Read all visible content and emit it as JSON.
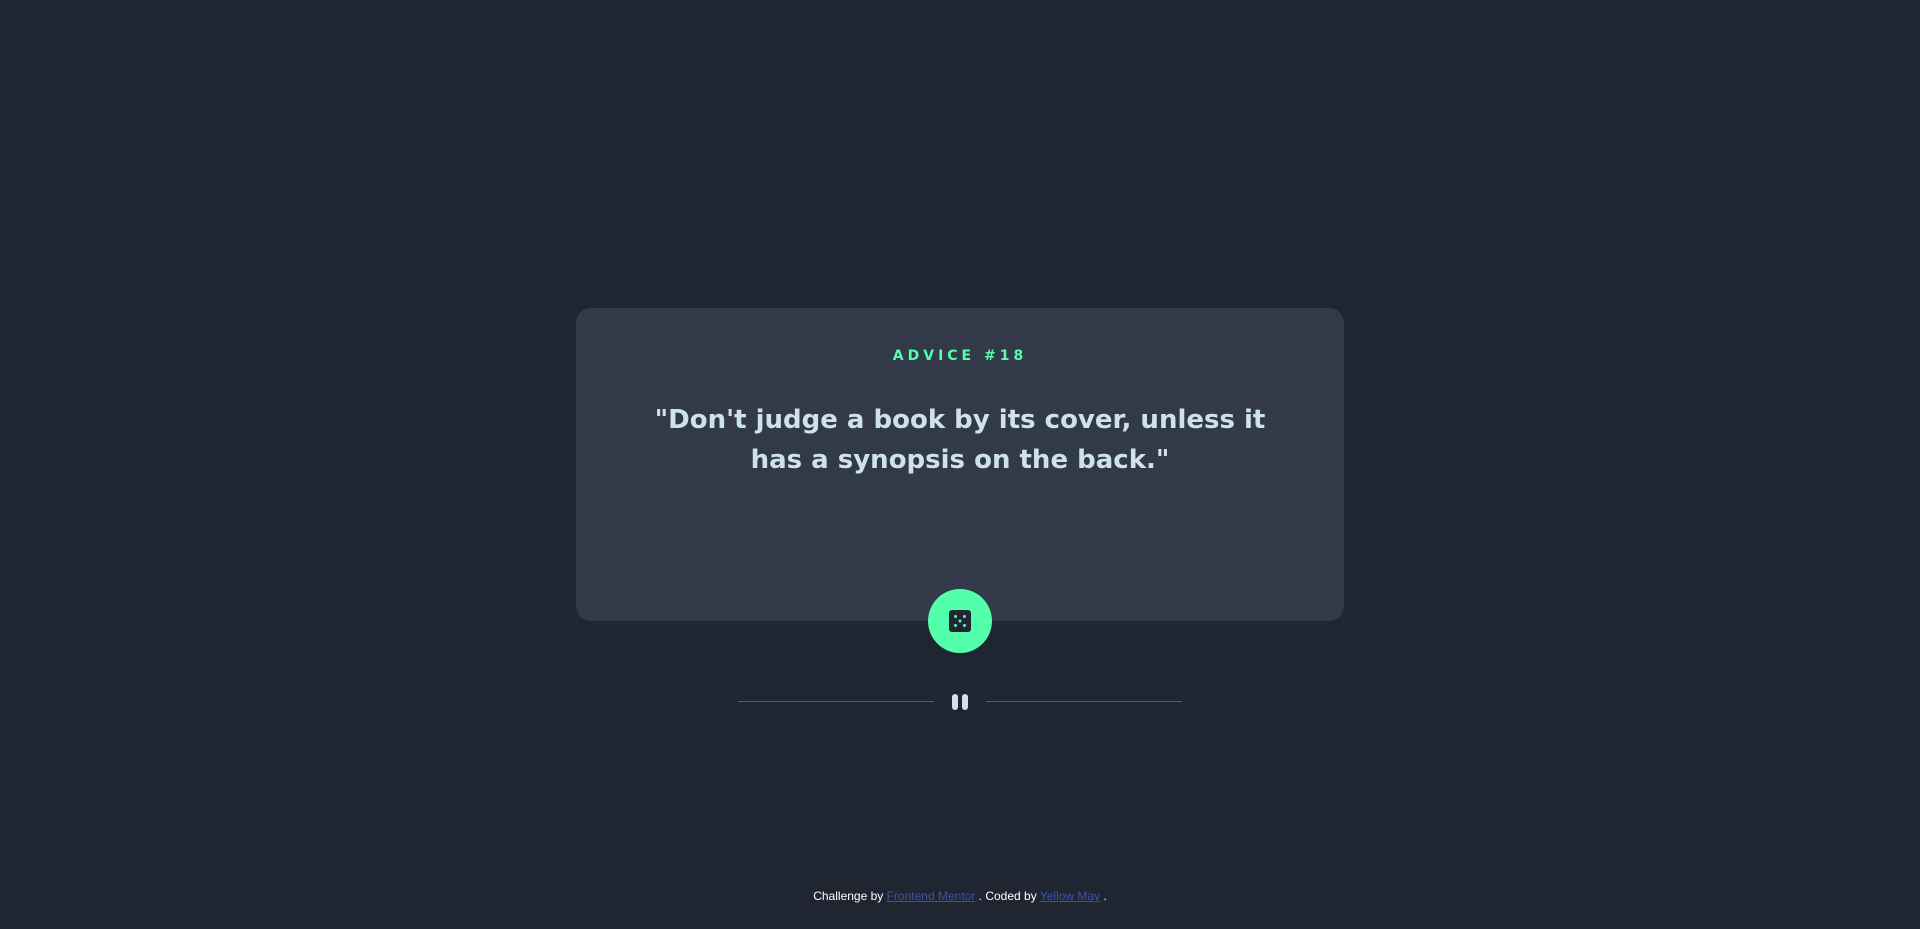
{
  "advice": {
    "label": "ADVICE #18",
    "quote": "\"Don't judge a book by its cover, unless it has a synopsis on the back.\""
  },
  "controls": {
    "dice_icon": "dice-icon",
    "pause_icon": "pause-icon"
  },
  "footer": {
    "prefix": "Challenge by ",
    "challenge_link": "Frontend Mentor",
    "middle": ". Coded by ",
    "author_link": "Yellow May",
    "suffix": "."
  },
  "colors": {
    "background": "#1f2631",
    "card": "#323a49",
    "accent": "#53ffaa",
    "text": "#cee3e9",
    "divider": "#4f5b6d",
    "link": "#3e52a3"
  }
}
